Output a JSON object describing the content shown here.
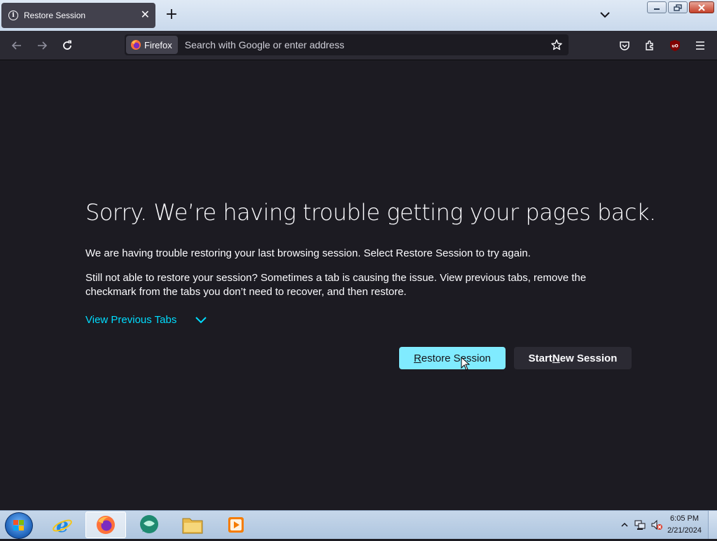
{
  "tab": {
    "title": "Restore Session"
  },
  "navbar": {
    "identity_label": "Firefox",
    "url_placeholder": "Search with Google or enter address"
  },
  "content": {
    "title": "Sorry. We’re having trouble getting your pages back.",
    "paragraph1": "We are having trouble restoring your last browsing session. Select Restore Session to try again.",
    "paragraph2": "Still not able to restore your session? Sometimes a tab is causing the issue. View previous tabs, remove the checkmark from the tabs you don’t need to recover, and then restore.",
    "view_previous": "View Previous Tabs",
    "restore_button": {
      "pre": "",
      "key": "R",
      "post": "estore Session"
    },
    "new_session_button": {
      "pre": "Start ",
      "key": "N",
      "post": "ew Session"
    }
  },
  "taskbar": {
    "time": "6:05 PM",
    "date": "2/21/2024"
  },
  "colors": {
    "page_bg": "#1c1b22",
    "accent_link": "#00ddff",
    "primary_button": "#80ebff"
  }
}
